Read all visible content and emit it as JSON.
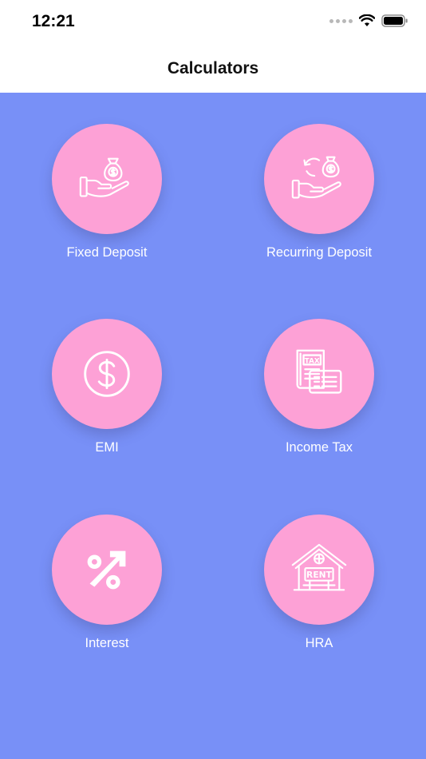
{
  "status_bar": {
    "time": "12:21"
  },
  "header": {
    "title": "Calculators"
  },
  "colors": {
    "background": "#7890f7",
    "circle": "#fda1d6",
    "label": "#ffffff"
  },
  "calculators": [
    {
      "label": "Fixed Deposit",
      "icon": "money-bag-hand-icon"
    },
    {
      "label": "Recurring Deposit",
      "icon": "money-bag-refresh-hand-icon"
    },
    {
      "label": "EMI",
      "icon": "dollar-coin-icon"
    },
    {
      "label": "Income Tax",
      "icon": "tax-document-icon"
    },
    {
      "label": "Interest",
      "icon": "percent-arrow-icon"
    },
    {
      "label": "HRA",
      "icon": "rent-house-icon"
    }
  ]
}
